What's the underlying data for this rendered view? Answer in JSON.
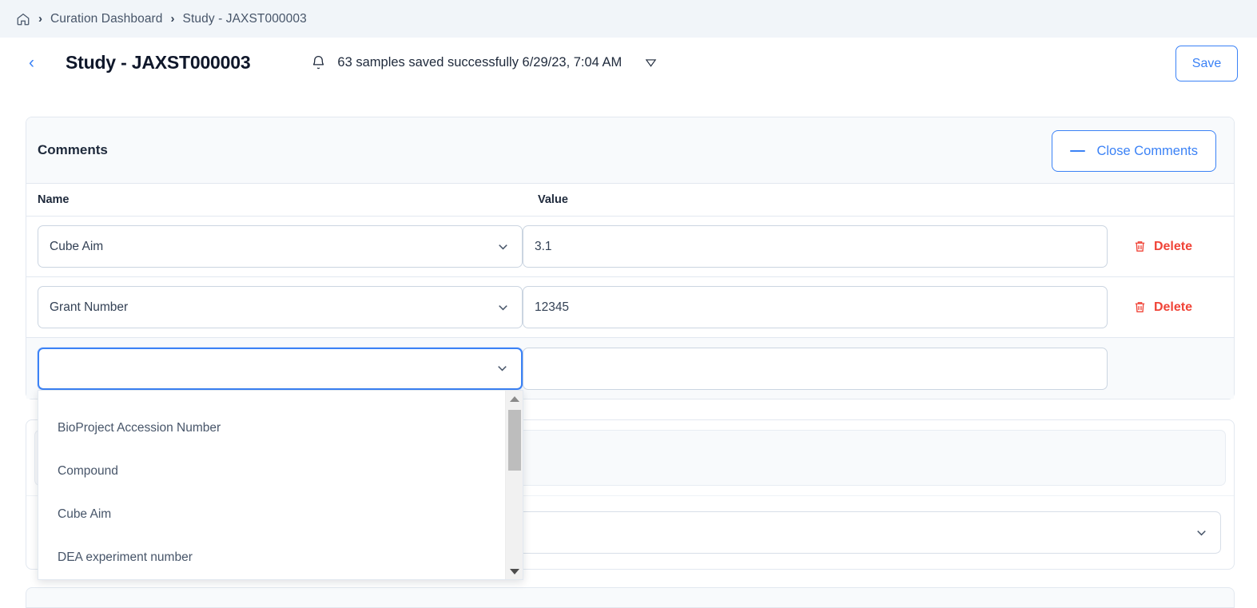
{
  "breadcrumb": {
    "home_icon": "home-icon",
    "separator": "›",
    "items": [
      {
        "label": "Curation Dashboard"
      },
      {
        "label": "Study - JAXST000003"
      }
    ]
  },
  "header": {
    "back_icon": "chevron-left-icon",
    "title": "Study - JAXST000003",
    "notification": {
      "bell_icon": "bell-icon",
      "message": "63 samples saved successfully 6/29/23, 7:04 AM",
      "caret_icon": "triangle-down-icon"
    },
    "save_label": "Save"
  },
  "comments_card": {
    "title": "Comments",
    "close_button": {
      "label": "Close Comments",
      "icon": "minus-icon"
    },
    "columns": {
      "name": "Name",
      "value": "Value"
    },
    "rows": [
      {
        "name": "Cube Aim",
        "value": "3.1",
        "value_placeholder": "",
        "delete_label": "Delete",
        "delete_icon": "trash-icon",
        "chevron_icon": "chevron-down-icon"
      },
      {
        "name": "Grant Number",
        "value": "12345",
        "value_placeholder": "",
        "delete_label": "Delete",
        "delete_icon": "trash-icon",
        "chevron_icon": "chevron-down-icon"
      },
      {
        "name": "",
        "value": "",
        "value_placeholder": "",
        "delete_label": "",
        "delete_icon": "",
        "chevron_icon": "chevron-down-icon"
      }
    ]
  },
  "dropdown": {
    "open": true,
    "options": [
      "BioProject Accession Number",
      "Compound",
      "Cube Aim",
      "DEA experiment number"
    ],
    "scroll_up_icon": "triangle-up-icon",
    "scroll_down_icon": "triangle-down-icon"
  },
  "background_section": {
    "select_chevron_icon": "chevron-down-icon"
  },
  "colors": {
    "accent_blue": "#3b82f6",
    "danger_red": "#f04438",
    "breadcrumb_bg": "#f1f5f9",
    "border": "#e2e8f0",
    "text_dark": "#1e293b",
    "text_muted": "#475569"
  }
}
